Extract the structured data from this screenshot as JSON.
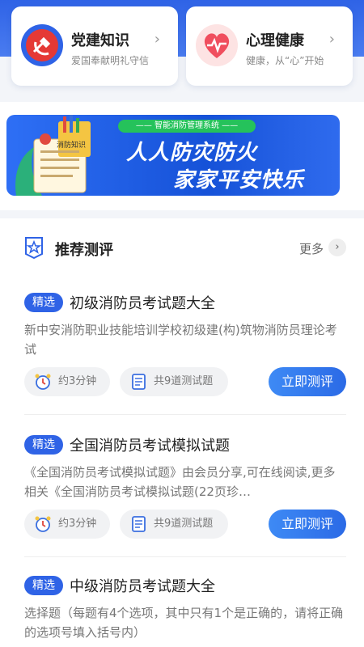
{
  "top_cards": [
    {
      "title": "党建知识",
      "subtitle": "爱国奉献明礼守信",
      "icon": "party-emblem-icon"
    },
    {
      "title": "心理健康",
      "subtitle": "健康，从“心”开始",
      "icon": "heart-pulse-icon"
    }
  ],
  "banner": {
    "chip": "—— 智能消防管理系统 ——",
    "line1": "人人防灾防火",
    "line2": "家家平安快乐",
    "art_label": "消防知识"
  },
  "section": {
    "title": "推荐测评",
    "more": "更多"
  },
  "items": [
    {
      "tag": "精选",
      "name": "初级消防员考试题大全",
      "desc": "新中安消防职业技能培训学校初级建(构)筑物消防员理论考试",
      "time": "约3分钟",
      "count": "共9道测试题",
      "button": "立即测评"
    },
    {
      "tag": "精选",
      "name": "全国消防员考试模拟试题",
      "desc": "《全国消防员考试模拟试题》由会员分享,可在线阅读,更多相关《全国消防员考试模拟试题(22页珍…",
      "time": "约3分钟",
      "count": "共9道测试题",
      "button": "立即测评"
    },
    {
      "tag": "精选",
      "name": "中级消防员考试题大全",
      "desc": "选择题（每题有4个选项，其中只有1个是正确的，请将正确的选项号填入括号内）"
    }
  ],
  "colors": {
    "brand_blue": "#2f63e6",
    "banner_chip": "#25c25b"
  }
}
